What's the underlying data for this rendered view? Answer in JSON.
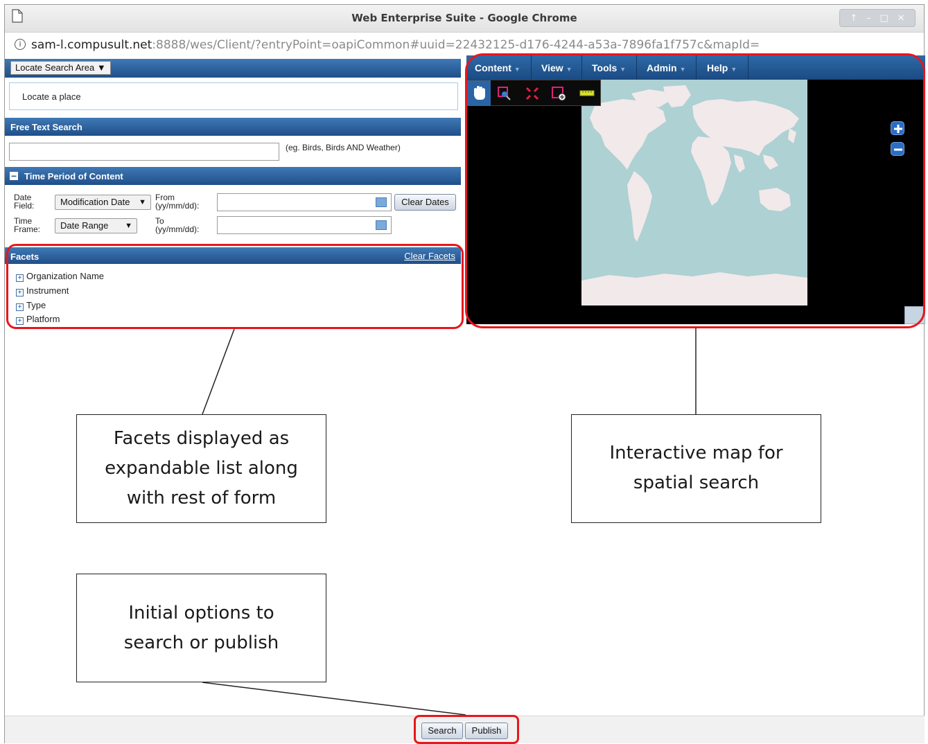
{
  "window": {
    "title": "Web Enterprise Suite - Google Chrome",
    "controls": [
      "↑",
      "–",
      "□",
      "✕"
    ]
  },
  "address_bar": {
    "host": "sam-l.compusult.net",
    "rest": ":8888/wes/Client/?entryPoint=oapiCommon#uuid=22432125-d176-4244-a53a-7896fa1f757c&mapId="
  },
  "locate": {
    "selector_label": "Locate Search Area",
    "placeholder": "Locate a place"
  },
  "free_text": {
    "header": "Free Text Search",
    "value": "",
    "hint": "(eg. Birds, Birds AND Weather)"
  },
  "time_period": {
    "header": "Time Period of Content",
    "date_field_label": [
      "Date",
      "Field:"
    ],
    "date_field_value": "Modification Date",
    "time_frame_label": [
      "Time",
      "Frame:"
    ],
    "time_frame_value": "Date Range",
    "from_label": [
      "From",
      "(yy/mm/dd):"
    ],
    "to_label": [
      "To",
      "(yy/mm/dd):"
    ],
    "from_value": "",
    "to_value": "",
    "clear_button": "Clear Dates"
  },
  "facets": {
    "header": "Facets",
    "clear_link": "Clear Facets",
    "items": [
      "Organization Name",
      "Instrument",
      "Type",
      "Platform"
    ]
  },
  "map": {
    "menus": [
      "Content",
      "View",
      "Tools",
      "Admin",
      "Help"
    ],
    "tools": [
      "pan-icon",
      "zoom-box-icon",
      "zoom-extent-icon",
      "select-area-icon",
      "measure-icon"
    ]
  },
  "callouts": {
    "facets": [
      "Facets displayed as",
      "expandable list along",
      "with rest of form"
    ],
    "map": [
      "Interactive map for",
      "spatial search"
    ],
    "buttons": [
      "Initial options to",
      "search or publish"
    ]
  },
  "footer": {
    "search_button": "Search",
    "publish_button": "Publish"
  },
  "colors": {
    "header_blue": "#1f4f8a",
    "highlight_red": "#e8161c",
    "ocean": "#aed1d3",
    "land": "#f2e9ea"
  }
}
